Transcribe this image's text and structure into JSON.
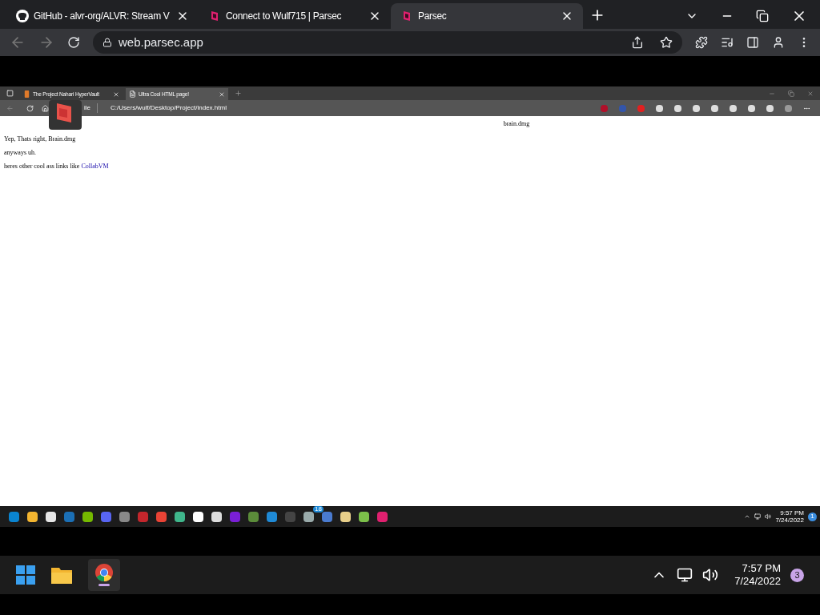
{
  "browser": {
    "tabs": [
      {
        "title": "GitHub - alvr-org/ALVR: Stream V",
        "kind": "github",
        "selected": false
      },
      {
        "title": "Connect to Wulf715 | Parsec",
        "kind": "parsec",
        "selected": false
      },
      {
        "title": "Parsec",
        "kind": "parsec",
        "selected": true
      }
    ],
    "address": "web.parsec.app"
  },
  "remote": {
    "tabs": [
      {
        "title": "The Project Nahari HyperVault",
        "kind": "orange",
        "selected": false
      },
      {
        "title": "Ultra Cool HTML page!",
        "kind": "page",
        "selected": true
      }
    ],
    "address_label": "ile",
    "address": "C:/Users/wulf/Desktop/Project/index.html",
    "page": {
      "heading": "brain.dmg",
      "lines": [
        "Yep, Thats right, Brain.dmg",
        "anyways uh."
      ],
      "link_sentence": "heres other cool ass links like",
      "link": "CollabVM"
    },
    "taskbar": {
      "badge": "18",
      "time": "9:57 PM",
      "date": "7/24/2022",
      "notifications": "1"
    }
  },
  "taskbar": {
    "time": "7:57 PM",
    "date": "7/24/2022",
    "notifications": "3"
  }
}
